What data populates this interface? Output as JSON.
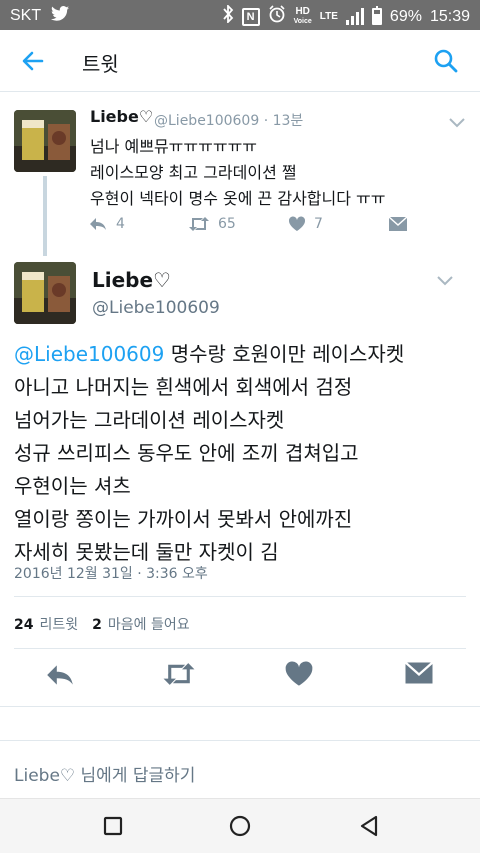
{
  "status_bar": {
    "carrier": "SKT",
    "battery": "69%",
    "battery_level": 0.69,
    "time": "15:39",
    "hd_label": "HD",
    "voice_label": "Voice",
    "network_label": "LTE"
  },
  "app_bar": {
    "title": "트윗"
  },
  "parent_tweet": {
    "name": "Liebe♡",
    "meta": "@Liebe100609 · 13분",
    "lines": [
      "넘나 예쁘뮤ㅠㅠㅠㅠㅠㅠ",
      "레이스모양 최고 그라데이션 쩔",
      "우현이 넥타이 명수 옷에 끈 감사합니다 ㅠㅠ"
    ],
    "reply_count": "4",
    "retweet_count": "65",
    "like_count": "7"
  },
  "main_tweet": {
    "name": "Liebe♡",
    "handle": "@Liebe100609",
    "mention": "@Liebe100609",
    "first_line_rest": " 명수랑 호원이만 레이스자켓",
    "lines": [
      "아니고 나머지는 흰색에서 회색에서 검정",
      "넘어가는 그라데이션 레이스자켓",
      "성규 쓰리피스 동우도 안에 조끼 겹쳐입고",
      "우현이는 셔츠",
      "열이랑 쫑이는 가까이서 못봐서 안에까진",
      "자세히 못봤는데 둘만 자켓이 김"
    ],
    "timestamp": "2016년 12월 31일 · 3:36 오후",
    "retweets": "24",
    "retweets_label": "리트윗",
    "likes": "2",
    "likes_label": "마음에 들어요"
  },
  "reply_box": {
    "placeholder": "Liebe♡ 님에게 답글하기"
  },
  "colors": {
    "accent": "#1da1f2",
    "muted": "#8899a6",
    "status_bar": "#6e6e6e"
  }
}
